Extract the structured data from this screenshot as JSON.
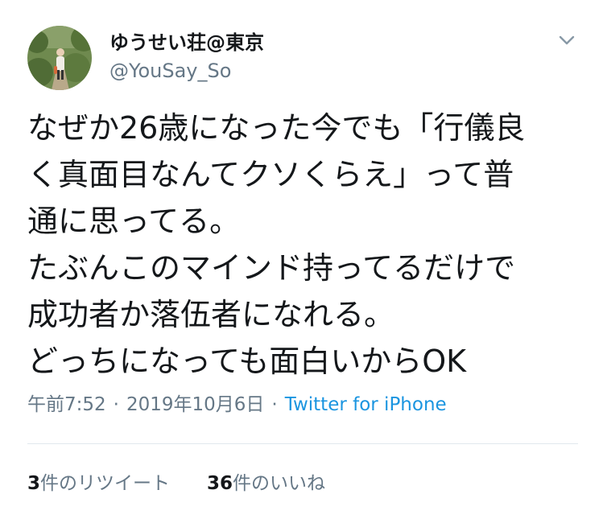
{
  "user": {
    "display_name": "ゆうせい荘@東京",
    "handle": "@YouSay_So"
  },
  "tweet": {
    "lines": [
      "なぜか26歳になった今でも「行儀良",
      "く真面目なんてクソくらえ」って普",
      "通に思ってる。",
      "たぶんこのマインド持ってるだけで",
      "成功者か落伍者になれる。",
      "どっちになっても面白いからOK"
    ]
  },
  "meta": {
    "time": "午前7:52",
    "date": "2019年10月6日",
    "separator": "·",
    "source": "Twitter for iPhone"
  },
  "stats": {
    "retweet_count": "3",
    "retweet_label": "件のリツイート",
    "like_count": "36",
    "like_label": "件のいいね"
  },
  "icons": {
    "menu": "chevron-down-icon",
    "avatar": "avatar"
  },
  "colors": {
    "text": "#14171a",
    "secondary": "#657786",
    "link": "#1b95e0",
    "divider": "#e1e8ed"
  }
}
